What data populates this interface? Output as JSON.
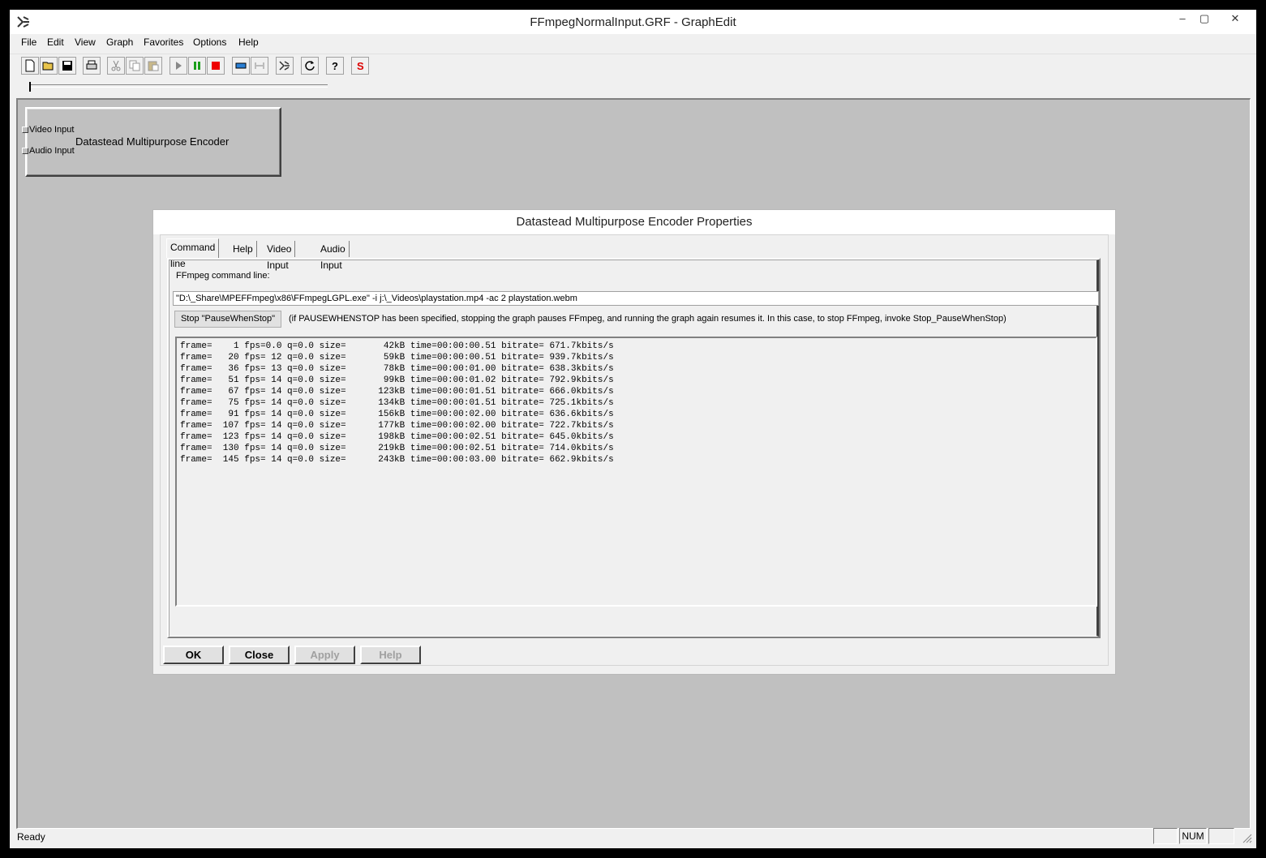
{
  "window": {
    "title": "FFmpegNormalInput.GRF - GraphEdit",
    "controls": {
      "minimize": "–",
      "maximize": "▢",
      "close": "✕"
    }
  },
  "menu": [
    "File",
    "Edit",
    "View",
    "Graph",
    "Favorites",
    "Options",
    "Help"
  ],
  "toolbar": {
    "icons": [
      "new-icon",
      "open-icon",
      "save-icon",
      "print-icon",
      "cut-icon",
      "copy-icon",
      "paste-icon",
      "play-icon",
      "pause-icon",
      "stop-icon",
      "seek-icon",
      "frame-step-icon",
      "graphedit-icon",
      "refresh-icon",
      "help-icon",
      "s-icon"
    ],
    "s_label": "S"
  },
  "filter": {
    "name": "Datastead Multipurpose Encoder",
    "pins": [
      "Video Input",
      "Audio Input"
    ]
  },
  "dialog": {
    "title": "Datastead Multipurpose Encoder Properties",
    "tabs": [
      "Command line",
      "Help",
      "Video Input",
      "Audio Input"
    ],
    "active_tab": "Command line",
    "cmd_label": "FFmpeg command line:",
    "cmd_value": "\"D:\\_Share\\MPEFFmpeg\\x86\\FFmpegLGPL.exe\" -i j:\\_Videos\\playstation.mp4 -ac 2 playstation.webm",
    "stop_button": "Stop \"PauseWhenStop\"",
    "stop_note": "(if PAUSEWHENSTOP has been specified, stopping the graph pauses FFmpeg, and running the graph again resumes it. In this case, to stop FFmpeg, invoke Stop_PauseWhenStop)",
    "log": [
      "frame=    1 fps=0.0 q=0.0 size=       42kB time=00:00:00.51 bitrate= 671.7kbits/s",
      "frame=   20 fps= 12 q=0.0 size=       59kB time=00:00:00.51 bitrate= 939.7kbits/s",
      "frame=   36 fps= 13 q=0.0 size=       78kB time=00:00:01.00 bitrate= 638.3kbits/s",
      "frame=   51 fps= 14 q=0.0 size=       99kB time=00:00:01.02 bitrate= 792.9kbits/s",
      "frame=   67 fps= 14 q=0.0 size=      123kB time=00:00:01.51 bitrate= 666.0kbits/s",
      "frame=   75 fps= 14 q=0.0 size=      134kB time=00:00:01.51 bitrate= 725.1kbits/s",
      "frame=   91 fps= 14 q=0.0 size=      156kB time=00:00:02.00 bitrate= 636.6kbits/s",
      "frame=  107 fps= 14 q=0.0 size=      177kB time=00:00:02.00 bitrate= 722.7kbits/s",
      "frame=  123 fps= 14 q=0.0 size=      198kB time=00:00:02.51 bitrate= 645.0kbits/s",
      "frame=  130 fps= 14 q=0.0 size=      219kB time=00:00:02.51 bitrate= 714.0kbits/s",
      "frame=  145 fps= 14 q=0.0 size=      243kB time=00:00:03.00 bitrate= 662.9kbits/s"
    ],
    "buttons": {
      "ok": "OK",
      "close": "Close",
      "apply": "Apply",
      "help": "Help"
    }
  },
  "status": {
    "text": "Ready",
    "num": "NUM"
  }
}
